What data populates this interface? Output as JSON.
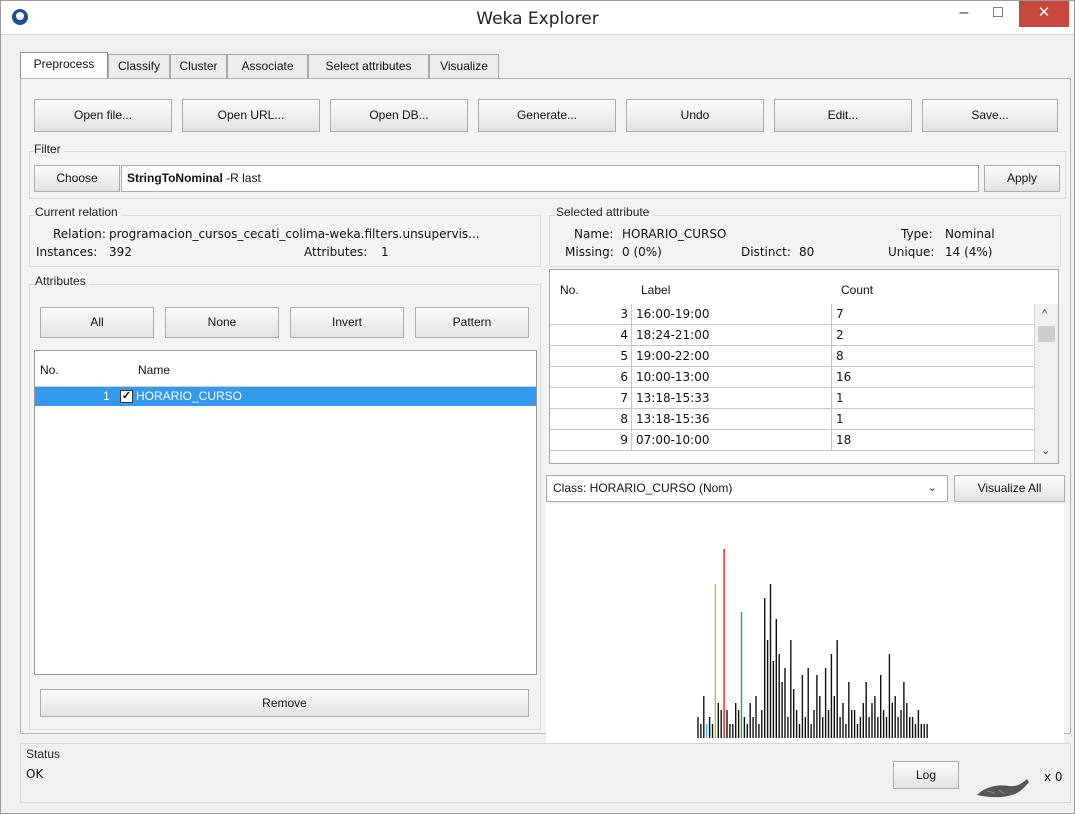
{
  "window": {
    "title": "Weka Explorer",
    "minimize": "–",
    "maximize": "□",
    "close": "✕"
  },
  "tabs": [
    "Preprocess",
    "Classify",
    "Cluster",
    "Associate",
    "Select attributes",
    "Visualize"
  ],
  "toolbar": {
    "open_file": "Open file...",
    "open_url": "Open URL...",
    "open_db": "Open DB...",
    "generate": "Generate...",
    "undo": "Undo",
    "edit": "Edit...",
    "save": "Save..."
  },
  "filter": {
    "group": "Filter",
    "choose": "Choose",
    "name": "StringToNominal",
    "options": "-R last",
    "apply": "Apply"
  },
  "relation": {
    "group": "Current relation",
    "relation_label": "Relation:",
    "relation_value": "programacion_cursos_cecati_colima-weka.filters.unsupervis...",
    "instances_label": "Instances:",
    "instances_value": "392",
    "attributes_label": "Attributes:",
    "attributes_value": "1"
  },
  "attributes": {
    "group": "Attributes",
    "all": "All",
    "none": "None",
    "invert": "Invert",
    "pattern": "Pattern",
    "col_no": "No.",
    "col_name": "Name",
    "rows": [
      {
        "no": "1",
        "name": "HORARIO_CURSO",
        "checked": true
      }
    ],
    "remove": "Remove"
  },
  "selected": {
    "group": "Selected attribute",
    "name_label": "Name:",
    "name_value": "HORARIO_CURSO",
    "type_label": "Type:",
    "type_value": "Nominal",
    "missing_label": "Missing:",
    "missing_value": "0 (0%)",
    "distinct_label": "Distinct:",
    "distinct_value": "80",
    "unique_label": "Unique:",
    "unique_value": "14 (4%)",
    "col_no": "No.",
    "col_label": "Label",
    "col_count": "Count",
    "rows": [
      {
        "no": "3",
        "label": "16:00-19:00",
        "count": "7"
      },
      {
        "no": "4",
        "label": "18:24-21:00",
        "count": "2"
      },
      {
        "no": "5",
        "label": "19:00-22:00",
        "count": "8"
      },
      {
        "no": "6",
        "label": "10:00-13:00",
        "count": "16"
      },
      {
        "no": "7",
        "label": "13:18-15:33",
        "count": "1"
      },
      {
        "no": "8",
        "label": "13:18-15:36",
        "count": "1"
      },
      {
        "no": "9",
        "label": "07:00-10:00",
        "count": "18"
      }
    ]
  },
  "class_select": {
    "value": "Class: HORARIO_CURSO (Nom)"
  },
  "visualize_all": "Visualize All",
  "histogram": {
    "values": [
      3,
      2,
      6,
      2,
      3,
      2,
      22,
      5,
      4,
      27,
      4,
      2,
      2,
      5,
      4,
      18,
      3,
      2,
      5,
      3,
      6,
      2,
      4,
      20,
      14,
      22,
      11,
      17,
      12,
      8,
      10,
      3,
      14,
      7,
      4,
      2,
      9,
      3,
      10,
      2,
      4,
      9,
      6,
      3,
      10,
      4,
      12,
      6,
      14,
      3,
      5,
      2,
      8,
      4,
      4,
      2,
      3,
      5,
      8,
      3,
      5,
      6,
      3,
      9,
      4,
      3,
      12,
      5,
      6,
      3,
      4,
      8,
      5,
      3,
      3,
      2,
      4,
      2,
      2,
      2
    ],
    "colors": {
      "3": "#33bbee",
      "6": "#99cc33",
      "9": "#dd2222",
      "15": "#22aa44"
    }
  },
  "status": {
    "group": "Status",
    "text": "OK",
    "log": "Log",
    "count": "x 0"
  }
}
